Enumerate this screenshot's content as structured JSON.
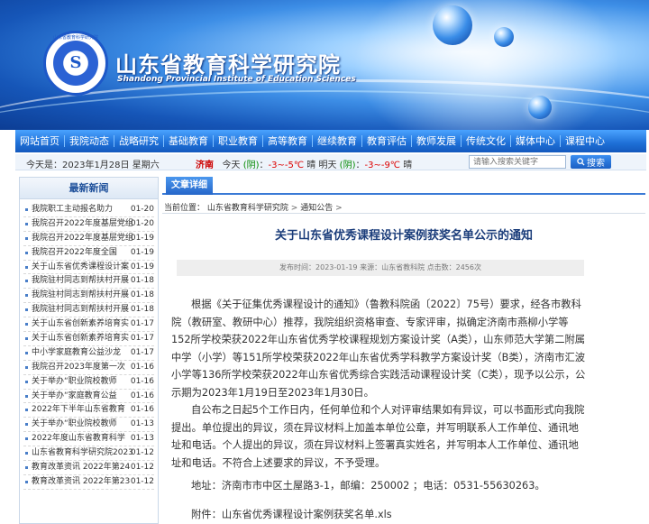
{
  "header": {
    "title": "山东省教育科学研究院",
    "subtitle": "Shandong Provincial Institute of Education Sciences",
    "logo_text": "山东省教育科学研究院",
    "logo_mark": "S"
  },
  "nav": {
    "items": [
      "网站首页",
      "我院动态",
      "战略研究",
      "基础教育",
      "职业教育",
      "高等教育",
      "继续教育",
      "教育评估",
      "教师发展",
      "传统文化",
      "媒体中心",
      "课程中心"
    ]
  },
  "infobar": {
    "date": "今天是：2023年1月28日 星期六",
    "city": "济南",
    "today_label": "今天",
    "today_weather": "(阴)",
    "today_temp": "-3~-5℃",
    "today_tail": "晴",
    "tomorrow_label": "明天",
    "tomorrow_weather": "(阴)",
    "tomorrow_temp": "-3~-9℃",
    "tomorrow_tail": "晴",
    "search_placeholder": "请输入搜索关键字",
    "search_button": "搜索"
  },
  "sidebar": {
    "heading": "最新新闻",
    "items": [
      {
        "title": "我院职工主动报名助力",
        "date": "01-20"
      },
      {
        "title": "我院召开2022年度基层党组",
        "date": "01-20"
      },
      {
        "title": "我院召开2022年度基层党组",
        "date": "01-19"
      },
      {
        "title": "我院召开2022年度全国",
        "date": "01-19"
      },
      {
        "title": "关于山东省优秀课程设计案",
        "date": "01-19"
      },
      {
        "title": "我院驻村同志到帮扶村开展",
        "date": "01-18"
      },
      {
        "title": "我院驻村同志到帮扶村开展",
        "date": "01-18"
      },
      {
        "title": "我院驻村同志到帮扶村开展",
        "date": "01-18"
      },
      {
        "title": "关于山东省创新素养培育实",
        "date": "01-17"
      },
      {
        "title": "关于山东省创新素养培育实",
        "date": "01-17"
      },
      {
        "title": "中小学家庭教育公益沙龙",
        "date": "01-17"
      },
      {
        "title": "我院召开2023年度第一次",
        "date": "01-16"
      },
      {
        "title": "关于举办“职业院校教师",
        "date": "01-16"
      },
      {
        "title": "关于举办“家庭教育公益",
        "date": "01-16"
      },
      {
        "title": "2022年下半年山东省教育",
        "date": "01-16"
      },
      {
        "title": "关于举办“职业院校教师",
        "date": "01-13"
      },
      {
        "title": "2022年度山东省教育科学",
        "date": "01-13"
      },
      {
        "title": "山东省教育科学研究院2023",
        "date": "01-12"
      },
      {
        "title": "教育改革资讯 2022年第24",
        "date": "01-12"
      },
      {
        "title": "教育改革资讯 2022年第23",
        "date": "01-12"
      }
    ]
  },
  "main": {
    "tab": "文章详细",
    "crumb_prefix": "当前位置：",
    "crumb_home": "山东省教育科学研究院",
    "crumb_sep": ">",
    "crumb_section": "通知公告",
    "crumb_tail": ">",
    "title": "关于山东省优秀课程设计案例获奖名单公示的通知",
    "meta": "发布时间：2023-01-19 来源：山东省教科院 点击数：2456次",
    "paragraph1": "根据《关于征集优秀课程设计的通知》（鲁教科院函〔2022〕75号）要求，经各市教科院（教研室、教研中心）推荐，我院组织资格审查、专家评审，拟确定济南市燕柳小学等152所学校荣获2022年山东省优秀学校课程规划方案设计奖（A类），山东师范大学第二附属中学（小学）等151所学校荣获2022年山东省优秀学科教学方案设计奖（B类），济南市汇波小学等136所学校荣获2022年山东省优秀综合实践活动课程设计奖（C类），现予以公示，公示期为2023年1月19日至2023年1月30日。",
    "paragraph2": "自公布之日起5个工作日内，任何单位和个人对评审结果如有异议，可以书面形式向我院提出。单位提出的异议，须在异议材料上加盖本单位公章，并写明联系人工作单位、通讯地址和电话。个人提出的异议，须在异议材料上签署真实姓名，并写明本人工作单位、通讯地址和电话。不符合上述要求的异议，不予受理。",
    "address": "地址：济南市市中区土屋路3-1，邮编：250002 ；电话：0531-55630263。",
    "attachment_label": "附件：",
    "attachment_file": "山东省优秀课程设计案例获奖名单.xls"
  }
}
